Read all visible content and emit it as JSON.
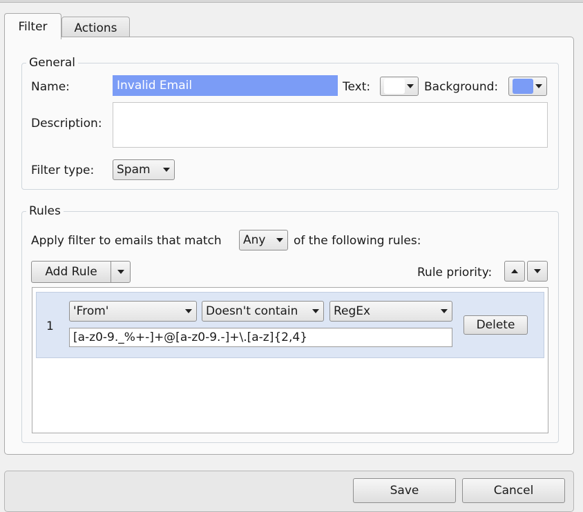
{
  "tabs": {
    "filter": "Filter",
    "actions": "Actions"
  },
  "general": {
    "title": "General",
    "name_label": "Name:",
    "name_value": "Invalid Email",
    "text_label": "Text:",
    "text_color": "#ffffff",
    "background_label": "Background:",
    "background_color": "#7b9cf6",
    "description_label": "Description:",
    "description_value": "",
    "filter_type_label": "Filter type:",
    "filter_type_value": "Spam"
  },
  "rules": {
    "title": "Rules",
    "apply_prefix": "Apply filter to emails that match",
    "match_value": "Any",
    "apply_suffix": "of the following rules:",
    "add_rule_label": "Add Rule",
    "priority_label": "Rule priority:",
    "items": [
      {
        "number": "1",
        "field": "'From'",
        "condition": "Doesn't contain",
        "match_type": "RegEx",
        "pattern": "[a-z0-9._%+-]+@[a-z0-9.-]+\\.[a-z]{2,4}",
        "delete_label": "Delete"
      }
    ]
  },
  "footer": {
    "save_label": "Save",
    "cancel_label": "Cancel"
  },
  "colors": {
    "selection": "#7b9cf6",
    "rule_row": "#dde6f5"
  }
}
